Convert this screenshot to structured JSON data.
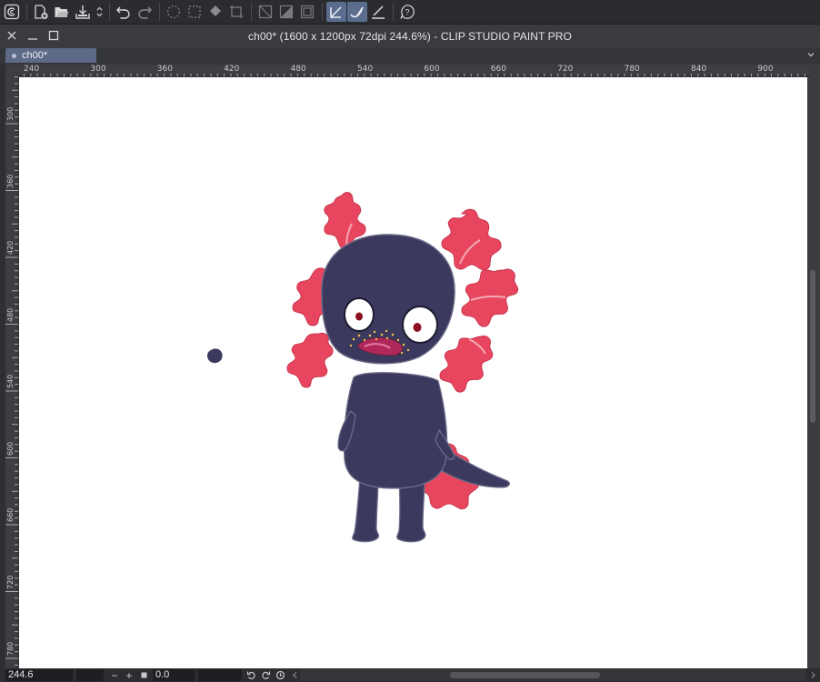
{
  "window": {
    "title": "ch00* (1600 x 1200px 72dpi 244.6%)  - CLIP STUDIO PAINT PRO"
  },
  "tab": {
    "label": "ch00*"
  },
  "toolbar": {
    "buttons": [
      "clip-studio-icon",
      "new-canvas-icon",
      "open-folder-icon",
      "export-icon",
      "chevron-updown-icon",
      "undo-icon",
      "redo-icon",
      "selection-dashed-icon",
      "deselect-icon",
      "fill-icon",
      "transform-icon",
      "clear-icon",
      "invert-fill-icon",
      "border-icon",
      "pen-stabilizer-icon",
      "brush-curve-icon",
      "ruler-pen-icon",
      "help-icon"
    ]
  },
  "ruler": {
    "horizontal": [
      "240",
      "300",
      "360",
      "420",
      "480",
      "540",
      "600",
      "660",
      "720",
      "780",
      "840",
      "900"
    ],
    "vertical": [
      "300",
      "360",
      "420",
      "480",
      "540",
      "600",
      "660",
      "720",
      "780"
    ]
  },
  "status": {
    "zoom_value": "244.6",
    "rotation_value": "0.0"
  },
  "colors": {
    "app_bg": "#3c3d41",
    "accent": "#5c6a88",
    "axolotl_body": "#3b3a5e",
    "axolotl_gills": "#e8465f"
  }
}
